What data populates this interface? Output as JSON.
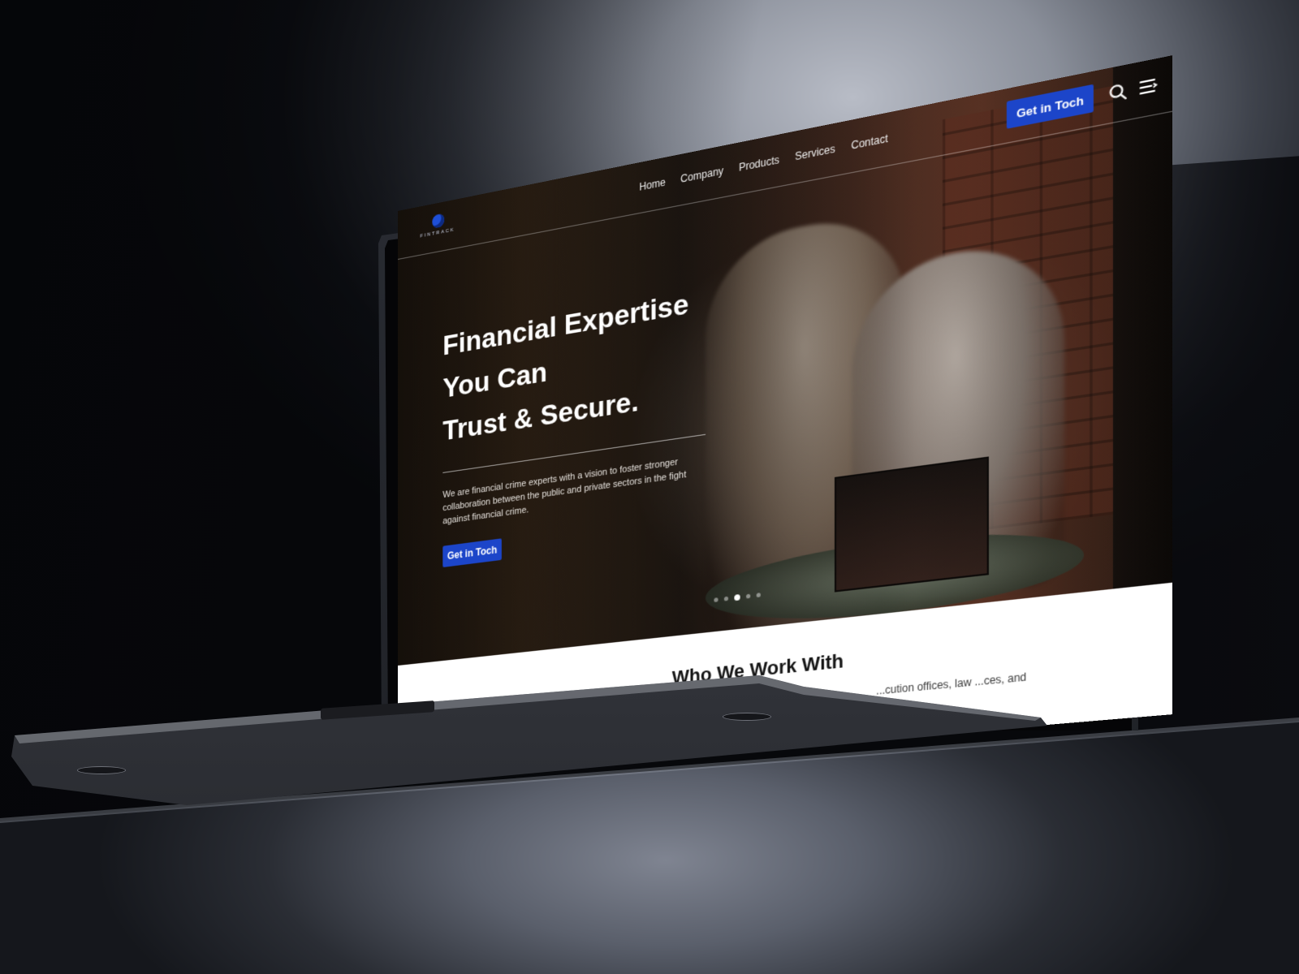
{
  "site": {
    "logo_text": "FINTRACK",
    "nav": [
      "Home",
      "Company",
      "Products",
      "Services",
      "Contact"
    ],
    "header_cta": "Get in Toch",
    "icons": {
      "search": "search-icon",
      "menu": "menu-icon"
    }
  },
  "hero": {
    "title_lines": [
      "Financial Expertise",
      "You Can",
      "Trust & Secure."
    ],
    "description": "We are financial crime experts with a vision to foster stronger collaboration between the public and private sectors in the fight against financial crime.",
    "cta": "Get in Toch",
    "slides_total": 5,
    "slide_active_index": 2
  },
  "section": {
    "title": "Who We Work With",
    "text_fragment": "...cution offices, law ...ces, and"
  },
  "colors": {
    "accent": "#1c45c9",
    "section_bg": "#ffffff"
  }
}
